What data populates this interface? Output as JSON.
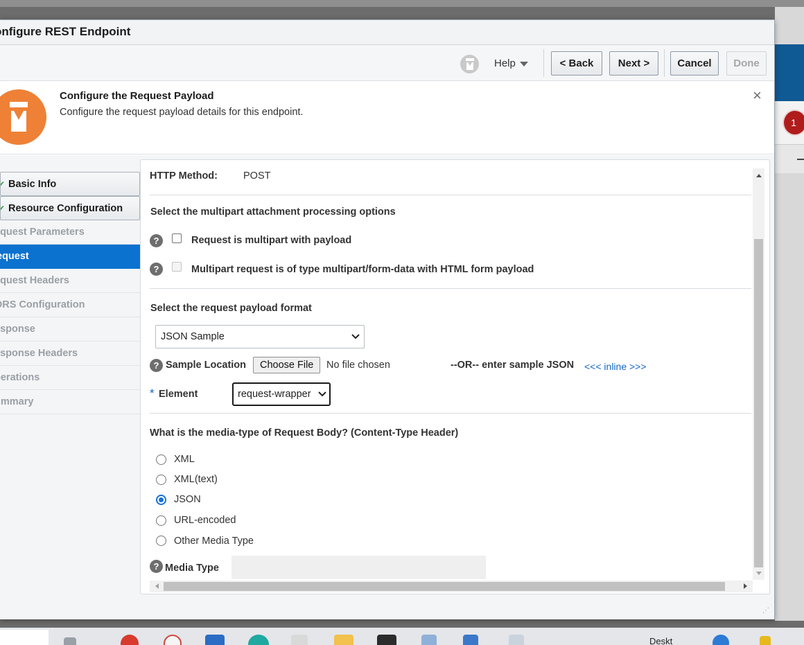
{
  "dialog": {
    "title": "onfigure REST Endpoint",
    "toolbar": {
      "help_label": "Help",
      "back_label": "< Back",
      "next_label": "Next >",
      "cancel_label": "Cancel",
      "done_label": "Done"
    },
    "header": {
      "title": "Configure the Request Payload",
      "subtitle": "Configure the request payload details for this endpoint.",
      "close_glyph": "×"
    }
  },
  "train": {
    "steps": [
      {
        "label": "Basic Info",
        "state": "done"
      },
      {
        "label": "Resource Configuration",
        "state": "done"
      },
      {
        "label": "equest Parameters",
        "state": "pending"
      },
      {
        "label": "equest",
        "state": "current"
      },
      {
        "label": "equest Headers",
        "state": "pending"
      },
      {
        "label": "ORS Configuration",
        "state": "pending"
      },
      {
        "label": "esponse",
        "state": "pending"
      },
      {
        "label": "esponse Headers",
        "state": "pending"
      },
      {
        "label": "perations",
        "state": "pending"
      },
      {
        "label": "ummary",
        "state": "pending"
      }
    ]
  },
  "form": {
    "http_method_label": "HTTP Method:",
    "http_method_value": "POST",
    "multipart_heading": "Select the multipart attachment processing options",
    "multipart_payload_label": "Request is multipart with payload",
    "multipart_form_label": "Multipart request is of type multipart/form-data with HTML form payload",
    "payload_format_heading": "Select the request payload format",
    "payload_format_value": "JSON Sample",
    "sample_location_label": "Sample Location",
    "choose_file_label": "Choose File",
    "no_file_text": "No file chosen",
    "or_text": "--OR-- enter sample JSON",
    "inline_link": "<<< inline >>>",
    "element_required": "*",
    "element_label": "Element",
    "element_value": "request-wrapper",
    "media_heading": "What is the media-type of Request Body? (Content-Type Header)",
    "media_options": [
      {
        "label": "XML",
        "selected": false
      },
      {
        "label": "XML(text)",
        "selected": false
      },
      {
        "label": "JSON",
        "selected": true
      },
      {
        "label": "URL-encoded",
        "selected": false
      },
      {
        "label": "Other Media Type",
        "selected": false
      }
    ],
    "media_type_label": "Media Type",
    "media_type_value": ""
  },
  "background": {
    "badge_count": "1"
  },
  "taskbar": {
    "desktop_label": "Deskt"
  },
  "colors": {
    "accent": "#0b72cf",
    "header_icon": "#ee8136",
    "check": "#2e9e3a",
    "link": "#1366c1"
  }
}
